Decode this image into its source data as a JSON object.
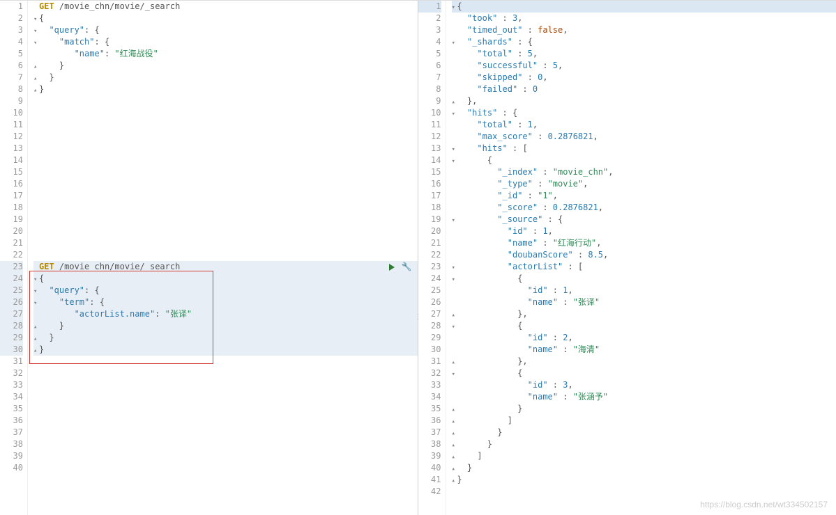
{
  "left": {
    "lines": [
      {
        "n": 1,
        "fold": "",
        "tokens": [
          [
            "method",
            "GET"
          ],
          [
            "plain",
            " "
          ],
          [
            "path",
            "/movie_chn/movie/_search"
          ]
        ]
      },
      {
        "n": 2,
        "fold": "▾",
        "tokens": [
          [
            "punc",
            "{"
          ]
        ]
      },
      {
        "n": 3,
        "fold": "▾",
        "tokens": [
          [
            "plain",
            "  "
          ],
          [
            "key",
            "\"query\""
          ],
          [
            "punc",
            ": {"
          ]
        ]
      },
      {
        "n": 4,
        "fold": "▾",
        "tokens": [
          [
            "plain",
            "    "
          ],
          [
            "key",
            "\"match\""
          ],
          [
            "punc",
            ": {"
          ]
        ]
      },
      {
        "n": 5,
        "fold": "",
        "tokens": [
          [
            "plain",
            "       "
          ],
          [
            "key",
            "\"name\""
          ],
          [
            "punc",
            ": "
          ],
          [
            "str",
            "\"红海战役\""
          ]
        ]
      },
      {
        "n": 6,
        "fold": "▴",
        "tokens": [
          [
            "plain",
            "    "
          ],
          [
            "punc",
            "}"
          ]
        ]
      },
      {
        "n": 7,
        "fold": "▴",
        "tokens": [
          [
            "plain",
            "  "
          ],
          [
            "punc",
            "}"
          ]
        ]
      },
      {
        "n": 8,
        "fold": "▴",
        "tokens": [
          [
            "punc",
            "}"
          ]
        ]
      },
      {
        "n": 9,
        "fold": "",
        "tokens": []
      },
      {
        "n": 10,
        "fold": "",
        "tokens": []
      },
      {
        "n": 11,
        "fold": "",
        "tokens": []
      },
      {
        "n": 12,
        "fold": "",
        "tokens": []
      },
      {
        "n": 13,
        "fold": "",
        "tokens": []
      },
      {
        "n": 14,
        "fold": "",
        "tokens": []
      },
      {
        "n": 15,
        "fold": "",
        "tokens": []
      },
      {
        "n": 16,
        "fold": "",
        "tokens": []
      },
      {
        "n": 17,
        "fold": "",
        "tokens": []
      },
      {
        "n": 18,
        "fold": "",
        "tokens": []
      },
      {
        "n": 19,
        "fold": "",
        "tokens": []
      },
      {
        "n": 20,
        "fold": "",
        "tokens": []
      },
      {
        "n": 21,
        "fold": "",
        "tokens": []
      },
      {
        "n": 22,
        "fold": "",
        "tokens": []
      },
      {
        "n": 23,
        "fold": "",
        "hl": "hl2",
        "actions": true,
        "tokens": [
          [
            "method",
            "GET"
          ],
          [
            "plain",
            " "
          ],
          [
            "path",
            "/movie_chn/movie/_search"
          ]
        ]
      },
      {
        "n": 24,
        "fold": "▾",
        "hl": "hl2",
        "tokens": [
          [
            "punc",
            "{"
          ]
        ]
      },
      {
        "n": 25,
        "fold": "▾",
        "hl": "hl2",
        "tokens": [
          [
            "plain",
            "  "
          ],
          [
            "key",
            "\"query\""
          ],
          [
            "punc",
            ": {"
          ]
        ]
      },
      {
        "n": 26,
        "fold": "▾",
        "hl": "hl2",
        "tokens": [
          [
            "plain",
            "    "
          ],
          [
            "key",
            "\"term\""
          ],
          [
            "punc",
            ": {"
          ]
        ]
      },
      {
        "n": 27,
        "fold": "",
        "hl": "hl2",
        "tokens": [
          [
            "plain",
            "       "
          ],
          [
            "key",
            "\"actorList.name\""
          ],
          [
            "punc",
            ": "
          ],
          [
            "str",
            "\"张译\""
          ]
        ]
      },
      {
        "n": 28,
        "fold": "▴",
        "hl": "hl2",
        "tokens": [
          [
            "plain",
            "    "
          ],
          [
            "punc",
            "}"
          ]
        ]
      },
      {
        "n": 29,
        "fold": "▴",
        "hl": "hl2",
        "tokens": [
          [
            "plain",
            "  "
          ],
          [
            "punc",
            "}"
          ]
        ]
      },
      {
        "n": 30,
        "fold": "▴",
        "hl": "hl2",
        "tokens": [
          [
            "punc",
            "}"
          ]
        ]
      },
      {
        "n": 31,
        "fold": "",
        "tokens": []
      },
      {
        "n": 32,
        "fold": "",
        "tokens": []
      },
      {
        "n": 33,
        "fold": "",
        "tokens": []
      },
      {
        "n": 34,
        "fold": "",
        "tokens": []
      },
      {
        "n": 35,
        "fold": "",
        "tokens": []
      },
      {
        "n": 36,
        "fold": "",
        "tokens": []
      },
      {
        "n": 37,
        "fold": "",
        "tokens": []
      },
      {
        "n": 38,
        "fold": "",
        "tokens": []
      },
      {
        "n": 39,
        "fold": "",
        "tokens": []
      },
      {
        "n": 40,
        "fold": "",
        "tokens": []
      }
    ]
  },
  "right": {
    "lines": [
      {
        "n": 1,
        "fold": "▾",
        "hl": "hl",
        "tokens": [
          [
            "punc",
            "{"
          ]
        ]
      },
      {
        "n": 2,
        "fold": "",
        "tokens": [
          [
            "plain",
            "  "
          ],
          [
            "key",
            "\"took\""
          ],
          [
            "punc",
            " : "
          ],
          [
            "num",
            "3"
          ],
          [
            "punc",
            ","
          ]
        ]
      },
      {
        "n": 3,
        "fold": "",
        "tokens": [
          [
            "plain",
            "  "
          ],
          [
            "key",
            "\"timed_out\""
          ],
          [
            "punc",
            " : "
          ],
          [
            "bool",
            "false"
          ],
          [
            "punc",
            ","
          ]
        ]
      },
      {
        "n": 4,
        "fold": "▾",
        "tokens": [
          [
            "plain",
            "  "
          ],
          [
            "key",
            "\"_shards\""
          ],
          [
            "punc",
            " : {"
          ]
        ]
      },
      {
        "n": 5,
        "fold": "",
        "tokens": [
          [
            "plain",
            "    "
          ],
          [
            "key",
            "\"total\""
          ],
          [
            "punc",
            " : "
          ],
          [
            "num",
            "5"
          ],
          [
            "punc",
            ","
          ]
        ]
      },
      {
        "n": 6,
        "fold": "",
        "tokens": [
          [
            "plain",
            "    "
          ],
          [
            "key",
            "\"successful\""
          ],
          [
            "punc",
            " : "
          ],
          [
            "num",
            "5"
          ],
          [
            "punc",
            ","
          ]
        ]
      },
      {
        "n": 7,
        "fold": "",
        "tokens": [
          [
            "plain",
            "    "
          ],
          [
            "key",
            "\"skipped\""
          ],
          [
            "punc",
            " : "
          ],
          [
            "num",
            "0"
          ],
          [
            "punc",
            ","
          ]
        ]
      },
      {
        "n": 8,
        "fold": "",
        "tokens": [
          [
            "plain",
            "    "
          ],
          [
            "key",
            "\"failed\""
          ],
          [
            "punc",
            " : "
          ],
          [
            "num",
            "0"
          ]
        ]
      },
      {
        "n": 9,
        "fold": "▴",
        "tokens": [
          [
            "plain",
            "  "
          ],
          [
            "punc",
            "},"
          ]
        ]
      },
      {
        "n": 10,
        "fold": "▾",
        "tokens": [
          [
            "plain",
            "  "
          ],
          [
            "key",
            "\"hits\""
          ],
          [
            "punc",
            " : {"
          ]
        ]
      },
      {
        "n": 11,
        "fold": "",
        "tokens": [
          [
            "plain",
            "    "
          ],
          [
            "key",
            "\"total\""
          ],
          [
            "punc",
            " : "
          ],
          [
            "num",
            "1"
          ],
          [
            "punc",
            ","
          ]
        ]
      },
      {
        "n": 12,
        "fold": "",
        "tokens": [
          [
            "plain",
            "    "
          ],
          [
            "key",
            "\"max_score\""
          ],
          [
            "punc",
            " : "
          ],
          [
            "num",
            "0.2876821"
          ],
          [
            "punc",
            ","
          ]
        ]
      },
      {
        "n": 13,
        "fold": "▾",
        "tokens": [
          [
            "plain",
            "    "
          ],
          [
            "key",
            "\"hits\""
          ],
          [
            "punc",
            " : ["
          ]
        ]
      },
      {
        "n": 14,
        "fold": "▾",
        "tokens": [
          [
            "plain",
            "      "
          ],
          [
            "punc",
            "{"
          ]
        ]
      },
      {
        "n": 15,
        "fold": "",
        "tokens": [
          [
            "plain",
            "        "
          ],
          [
            "key",
            "\"_index\""
          ],
          [
            "punc",
            " : "
          ],
          [
            "str",
            "\"movie_chn\""
          ],
          [
            "punc",
            ","
          ]
        ]
      },
      {
        "n": 16,
        "fold": "",
        "tokens": [
          [
            "plain",
            "        "
          ],
          [
            "key",
            "\"_type\""
          ],
          [
            "punc",
            " : "
          ],
          [
            "str",
            "\"movie\""
          ],
          [
            "punc",
            ","
          ]
        ]
      },
      {
        "n": 17,
        "fold": "",
        "tokens": [
          [
            "plain",
            "        "
          ],
          [
            "key",
            "\"_id\""
          ],
          [
            "punc",
            " : "
          ],
          [
            "str",
            "\"1\""
          ],
          [
            "punc",
            ","
          ]
        ]
      },
      {
        "n": 18,
        "fold": "",
        "tokens": [
          [
            "plain",
            "        "
          ],
          [
            "key",
            "\"_score\""
          ],
          [
            "punc",
            " : "
          ],
          [
            "num",
            "0.2876821"
          ],
          [
            "punc",
            ","
          ]
        ]
      },
      {
        "n": 19,
        "fold": "▾",
        "tokens": [
          [
            "plain",
            "        "
          ],
          [
            "key",
            "\"_source\""
          ],
          [
            "punc",
            " : {"
          ]
        ]
      },
      {
        "n": 20,
        "fold": "",
        "tokens": [
          [
            "plain",
            "          "
          ],
          [
            "key",
            "\"id\""
          ],
          [
            "punc",
            " : "
          ],
          [
            "num",
            "1"
          ],
          [
            "punc",
            ","
          ]
        ]
      },
      {
        "n": 21,
        "fold": "",
        "tokens": [
          [
            "plain",
            "          "
          ],
          [
            "key",
            "\"name\""
          ],
          [
            "punc",
            " : "
          ],
          [
            "str",
            "\"红海行动\""
          ],
          [
            "punc",
            ","
          ]
        ]
      },
      {
        "n": 22,
        "fold": "",
        "tokens": [
          [
            "plain",
            "          "
          ],
          [
            "key",
            "\"doubanScore\""
          ],
          [
            "punc",
            " : "
          ],
          [
            "num",
            "8.5"
          ],
          [
            "punc",
            ","
          ]
        ]
      },
      {
        "n": 23,
        "fold": "▾",
        "tokens": [
          [
            "plain",
            "          "
          ],
          [
            "key",
            "\"actorList\""
          ],
          [
            "punc",
            " : ["
          ]
        ]
      },
      {
        "n": 24,
        "fold": "▾",
        "tokens": [
          [
            "plain",
            "            "
          ],
          [
            "punc",
            "{"
          ]
        ]
      },
      {
        "n": 25,
        "fold": "",
        "tokens": [
          [
            "plain",
            "              "
          ],
          [
            "key",
            "\"id\""
          ],
          [
            "punc",
            " : "
          ],
          [
            "num",
            "1"
          ],
          [
            "punc",
            ","
          ]
        ]
      },
      {
        "n": 26,
        "fold": "",
        "tokens": [
          [
            "plain",
            "              "
          ],
          [
            "key",
            "\"name\""
          ],
          [
            "punc",
            " : "
          ],
          [
            "str",
            "\"张译\""
          ]
        ]
      },
      {
        "n": 27,
        "fold": "▴",
        "tokens": [
          [
            "plain",
            "            "
          ],
          [
            "punc",
            "},"
          ]
        ]
      },
      {
        "n": 28,
        "fold": "▾",
        "tokens": [
          [
            "plain",
            "            "
          ],
          [
            "punc",
            "{"
          ]
        ]
      },
      {
        "n": 29,
        "fold": "",
        "tokens": [
          [
            "plain",
            "              "
          ],
          [
            "key",
            "\"id\""
          ],
          [
            "punc",
            " : "
          ],
          [
            "num",
            "2"
          ],
          [
            "punc",
            ","
          ]
        ]
      },
      {
        "n": 30,
        "fold": "",
        "tokens": [
          [
            "plain",
            "              "
          ],
          [
            "key",
            "\"name\""
          ],
          [
            "punc",
            " : "
          ],
          [
            "str",
            "\"海清\""
          ]
        ]
      },
      {
        "n": 31,
        "fold": "▴",
        "tokens": [
          [
            "plain",
            "            "
          ],
          [
            "punc",
            "},"
          ]
        ]
      },
      {
        "n": 32,
        "fold": "▾",
        "tokens": [
          [
            "plain",
            "            "
          ],
          [
            "punc",
            "{"
          ]
        ]
      },
      {
        "n": 33,
        "fold": "",
        "tokens": [
          [
            "plain",
            "              "
          ],
          [
            "key",
            "\"id\""
          ],
          [
            "punc",
            " : "
          ],
          [
            "num",
            "3"
          ],
          [
            "punc",
            ","
          ]
        ]
      },
      {
        "n": 34,
        "fold": "",
        "tokens": [
          [
            "plain",
            "              "
          ],
          [
            "key",
            "\"name\""
          ],
          [
            "punc",
            " : "
          ],
          [
            "str",
            "\"张涵予\""
          ]
        ]
      },
      {
        "n": 35,
        "fold": "▴",
        "tokens": [
          [
            "plain",
            "            "
          ],
          [
            "punc",
            "}"
          ]
        ]
      },
      {
        "n": 36,
        "fold": "▴",
        "tokens": [
          [
            "plain",
            "          "
          ],
          [
            "punc",
            "]"
          ]
        ]
      },
      {
        "n": 37,
        "fold": "▴",
        "tokens": [
          [
            "plain",
            "        "
          ],
          [
            "punc",
            "}"
          ]
        ]
      },
      {
        "n": 38,
        "fold": "▴",
        "tokens": [
          [
            "plain",
            "      "
          ],
          [
            "punc",
            "}"
          ]
        ]
      },
      {
        "n": 39,
        "fold": "▴",
        "tokens": [
          [
            "plain",
            "    "
          ],
          [
            "punc",
            "]"
          ]
        ]
      },
      {
        "n": 40,
        "fold": "▴",
        "tokens": [
          [
            "plain",
            "  "
          ],
          [
            "punc",
            "}"
          ]
        ]
      },
      {
        "n": 41,
        "fold": "▴",
        "tokens": [
          [
            "punc",
            "}"
          ]
        ]
      },
      {
        "n": 42,
        "fold": "",
        "tokens": []
      }
    ]
  },
  "watermark": "https://blog.csdn.net/wt334502157"
}
